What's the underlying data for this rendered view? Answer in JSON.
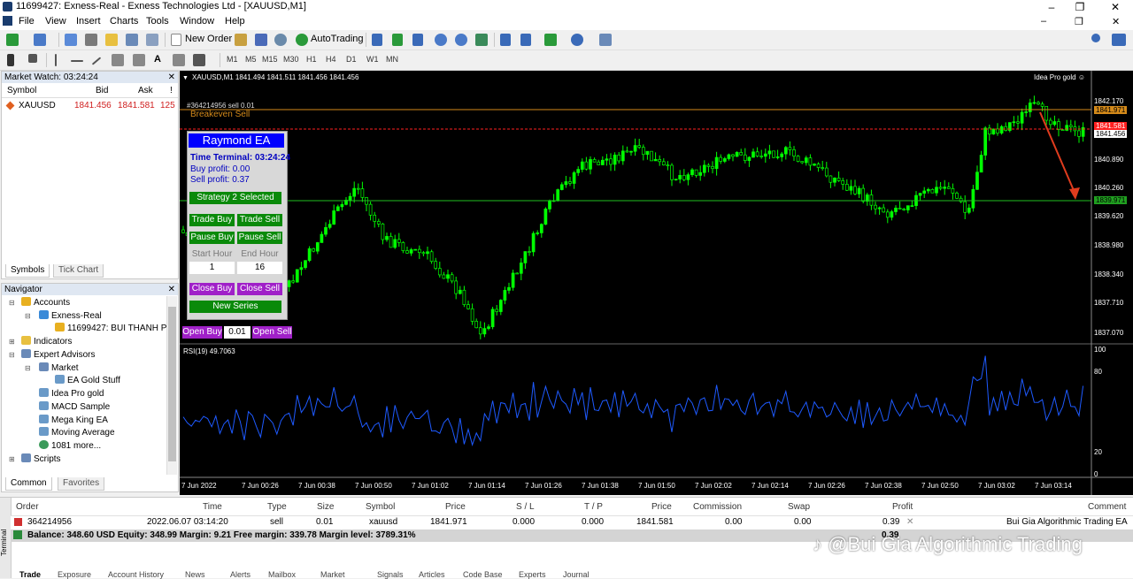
{
  "window": {
    "title": "11699427: Exness-Real - Exness Technologies Ltd - [XAUUSD,M1]",
    "controls": [
      "–",
      "❐",
      "✕"
    ]
  },
  "menu": [
    "File",
    "View",
    "Insert",
    "Charts",
    "Tools",
    "Window",
    "Help"
  ],
  "menu_controls": [
    "–",
    "❐",
    "✕"
  ],
  "toolbar": {
    "new_order": "New Order",
    "autotrading": "AutoTrading",
    "timeframes": [
      "M1",
      "M5",
      "M15",
      "M30",
      "H1",
      "H4",
      "D1",
      "W1",
      "MN"
    ],
    "active_timeframe": "M1"
  },
  "market_watch": {
    "title": "Market Watch: 03:24:24",
    "columns": [
      "Symbol",
      "Bid",
      "Ask",
      "!"
    ],
    "rows": [
      {
        "symbol": "XAUUSD",
        "bid": "1841.456",
        "ask": "1841.581",
        "spread": "125"
      }
    ],
    "tabs": [
      "Symbols",
      "Tick Chart"
    ]
  },
  "navigator": {
    "title": "Navigator",
    "items": [
      {
        "label": "Accounts",
        "icon": "accounts-icon"
      },
      {
        "label": "Exness-Real",
        "icon": "server-icon"
      },
      {
        "label": "11699427: BUI THANH P",
        "icon": "account-icon"
      },
      {
        "label": "Indicators",
        "icon": "indicators-icon"
      },
      {
        "label": "Expert Advisors",
        "icon": "experts-icon"
      },
      {
        "label": "Market",
        "icon": "market-icon"
      },
      {
        "label": "EA Gold Stuff",
        "icon": "expert-icon"
      },
      {
        "label": "Idea Pro gold",
        "icon": "expert-icon"
      },
      {
        "label": "MACD Sample",
        "icon": "expert-icon"
      },
      {
        "label": "Mega King EA",
        "icon": "expert-icon"
      },
      {
        "label": "Moving Average",
        "icon": "expert-icon"
      },
      {
        "label": "1081 more...",
        "icon": "globe-icon"
      },
      {
        "label": "Scripts",
        "icon": "scripts-icon"
      }
    ],
    "tabs": [
      "Common",
      "Favorites"
    ]
  },
  "chart": {
    "header": "XAUUSD,M1  1841.494 1841.511 1841.456 1841.456",
    "expert_name": "Idea Pro gold",
    "order_label": "#364214956 sell 0.01",
    "breakeven_label": "Breakeven Sell",
    "price_axis": [
      "1842.170",
      "1841.971",
      "1841.581",
      "1841.456",
      "1840.890",
      "1840.260",
      "1839.971",
      "1839.620",
      "1838.980",
      "1838.340",
      "1837.710",
      "1837.070"
    ],
    "rsi_label": "RSI(19) 49.7063",
    "rsi_axis": [
      "100",
      "80",
      "20",
      "0"
    ],
    "time_axis": [
      "7 Jun 2022",
      "7 Jun 00:26",
      "7 Jun 00:38",
      "7 Jun 00:50",
      "7 Jun 01:02",
      "7 Jun 01:14",
      "7 Jun 01:26",
      "7 Jun 01:38",
      "7 Jun 01:50",
      "7 Jun 02:02",
      "7 Jun 02:14",
      "7 Jun 02:26",
      "7 Jun 02:38",
      "7 Jun 02:50",
      "7 Jun 03:02",
      "7 Jun 03:14"
    ]
  },
  "ea_panel": {
    "title": "Raymond EA",
    "time": "Time Terminal: 03:24:24",
    "buy_profit": "Buy profit: 0.00",
    "sell_profit": "Sell profit: 0.37",
    "strategy": "Strategy 2 Selected",
    "trade_buy": "Trade Buy",
    "trade_sell": "Trade Sell",
    "pause_buy": "Pause Buy",
    "pause_sell": "Pause Sell",
    "start_hour_label": "Start Hour",
    "end_hour_label": "End Hour",
    "start_hour": "1",
    "end_hour": "16",
    "close_buy": "Close Buy",
    "close_sell": "Close Sell",
    "new_series": "New Series",
    "open_buy": "Open Buy",
    "lot": "0.01",
    "open_sell": "Open Sell"
  },
  "terminal": {
    "columns": [
      "Order",
      "Time",
      "Type",
      "Size",
      "Symbol",
      "Price",
      "S / L",
      "T / P",
      "Price",
      "Commission",
      "Swap",
      "Profit",
      "Comment"
    ],
    "row": [
      "364214956",
      "2022.06.07 03:14:20",
      "sell",
      "0.01",
      "xauusd",
      "1841.971",
      "0.000",
      "0.000",
      "1841.581",
      "0.00",
      "0.00",
      "0.39",
      "Bui Gia Algorithmic Trading EA"
    ],
    "balance": "Balance: 348.60 USD  Equity: 348.99  Margin: 9.21  Free margin: 339.78  Margin level: 3789.31%",
    "balance_profit": "0.39",
    "tabs": [
      "Trade",
      "Exposure",
      "Account History",
      "News",
      "Alerts",
      "Mailbox",
      "Market",
      "Signals",
      "Articles",
      "Code Base",
      "Experts",
      "Journal"
    ],
    "side_label": "Terminal"
  },
  "watermark": "@Bui Gia Algorithmic Trading",
  "colors": {
    "candle": "#00ff00",
    "rsi": "#1e5aff",
    "chart_bg": "#000000",
    "ea_green": "#0a8a0a",
    "ea_purple": "#a020c8",
    "ea_blue": "#0000ff",
    "arrow": "#e03c1e"
  }
}
